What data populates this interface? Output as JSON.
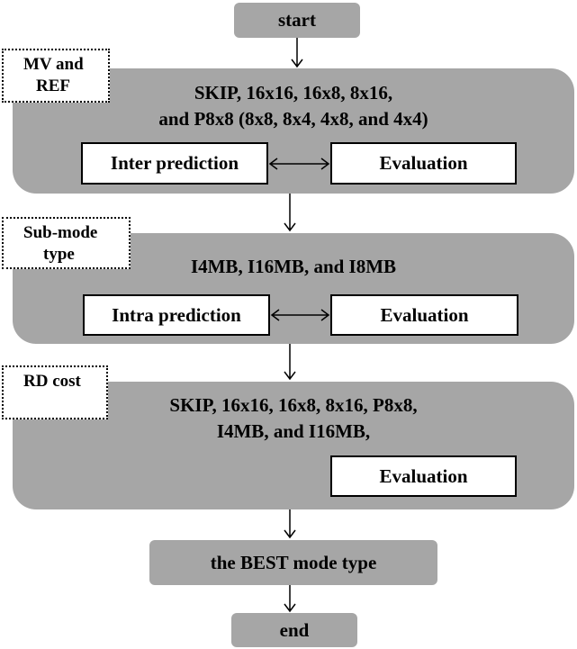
{
  "start": "start",
  "end": "end",
  "best": "the BEST mode type",
  "panels": [
    {
      "label_line1": "MV and",
      "label_line2": "REF",
      "line1": "SKIP, 16x16, 16x8, 8x16,",
      "line2": "and P8x8 (8x8, 8x4, 4x8, and 4x4)",
      "left_box": "Inter prediction",
      "right_box": "Evaluation"
    },
    {
      "label_line1": "Sub-mode",
      "label_line2": "type",
      "line1": "I4MB, I16MB, and I8MB",
      "left_box": "Intra prediction",
      "right_box": "Evaluation"
    },
    {
      "label_line1": "RD cost",
      "line1": "SKIP, 16x16, 16x8, 8x16, P8x8,",
      "line2": "I4MB, and I16MB,",
      "right_box": "Evaluation"
    }
  ],
  "colors": {
    "fill": "#a6a6a6"
  }
}
